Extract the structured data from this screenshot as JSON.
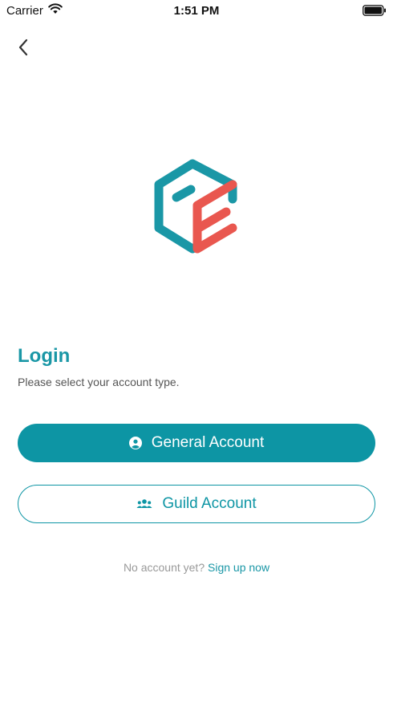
{
  "status_bar": {
    "carrier": "Carrier",
    "time": "1:51 PM",
    "wifi_icon": "wifi-icon",
    "battery_icon": "battery-icon"
  },
  "nav": {
    "back_icon": "chevron-left-icon"
  },
  "logo": {
    "icon": "cube-e-logo",
    "colors": {
      "teal": "#1a97a6",
      "coral": "#e9574f"
    }
  },
  "login": {
    "title": "Login",
    "subtitle": "Please select your account type.",
    "general_button": {
      "label": "General Account",
      "icon": "user-circle-icon"
    },
    "guild_button": {
      "label": "Guild Account",
      "icon": "group-icon"
    },
    "signup_prompt": "No account yet?",
    "signup_link": "Sign up now"
  },
  "colors": {
    "accent": "#0d95a4",
    "text_muted": "#999999",
    "background": "#ffffff"
  }
}
